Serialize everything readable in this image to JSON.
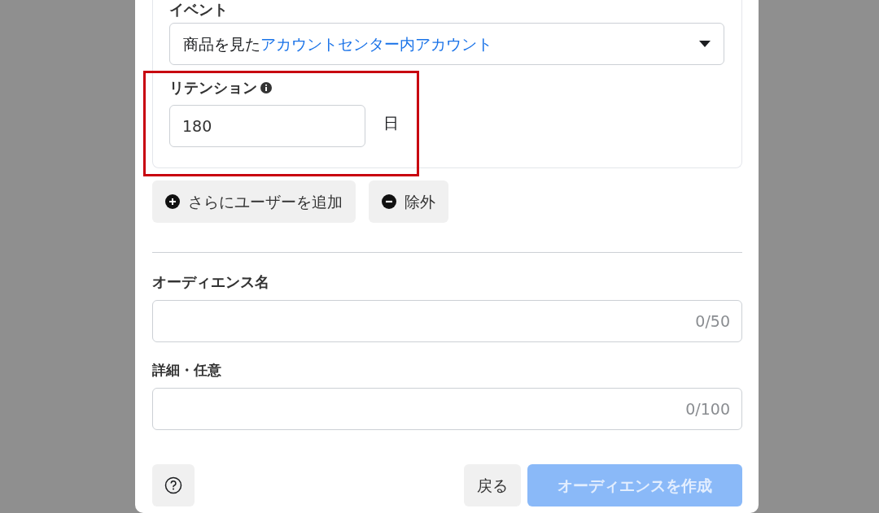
{
  "event": {
    "label": "イベント",
    "value": "商品を見た",
    "value_link": "アカウントセンター内アカウント"
  },
  "retention": {
    "label": "リテンション",
    "value": "180",
    "unit": "日",
    "highlighted": true
  },
  "rule_buttons": [
    {
      "kind": "add",
      "label": "さらにユーザーを追加"
    },
    {
      "kind": "exclude",
      "label": "除外"
    }
  ],
  "fields": [
    {
      "label": "オーディエンス名",
      "counter": "0/50"
    },
    {
      "label": "詳細・任意",
      "counter": "0/100"
    }
  ],
  "footer": {
    "back": "戻る",
    "create": {
      "label": "オーディエンスを作成",
      "disabled": true
    }
  }
}
